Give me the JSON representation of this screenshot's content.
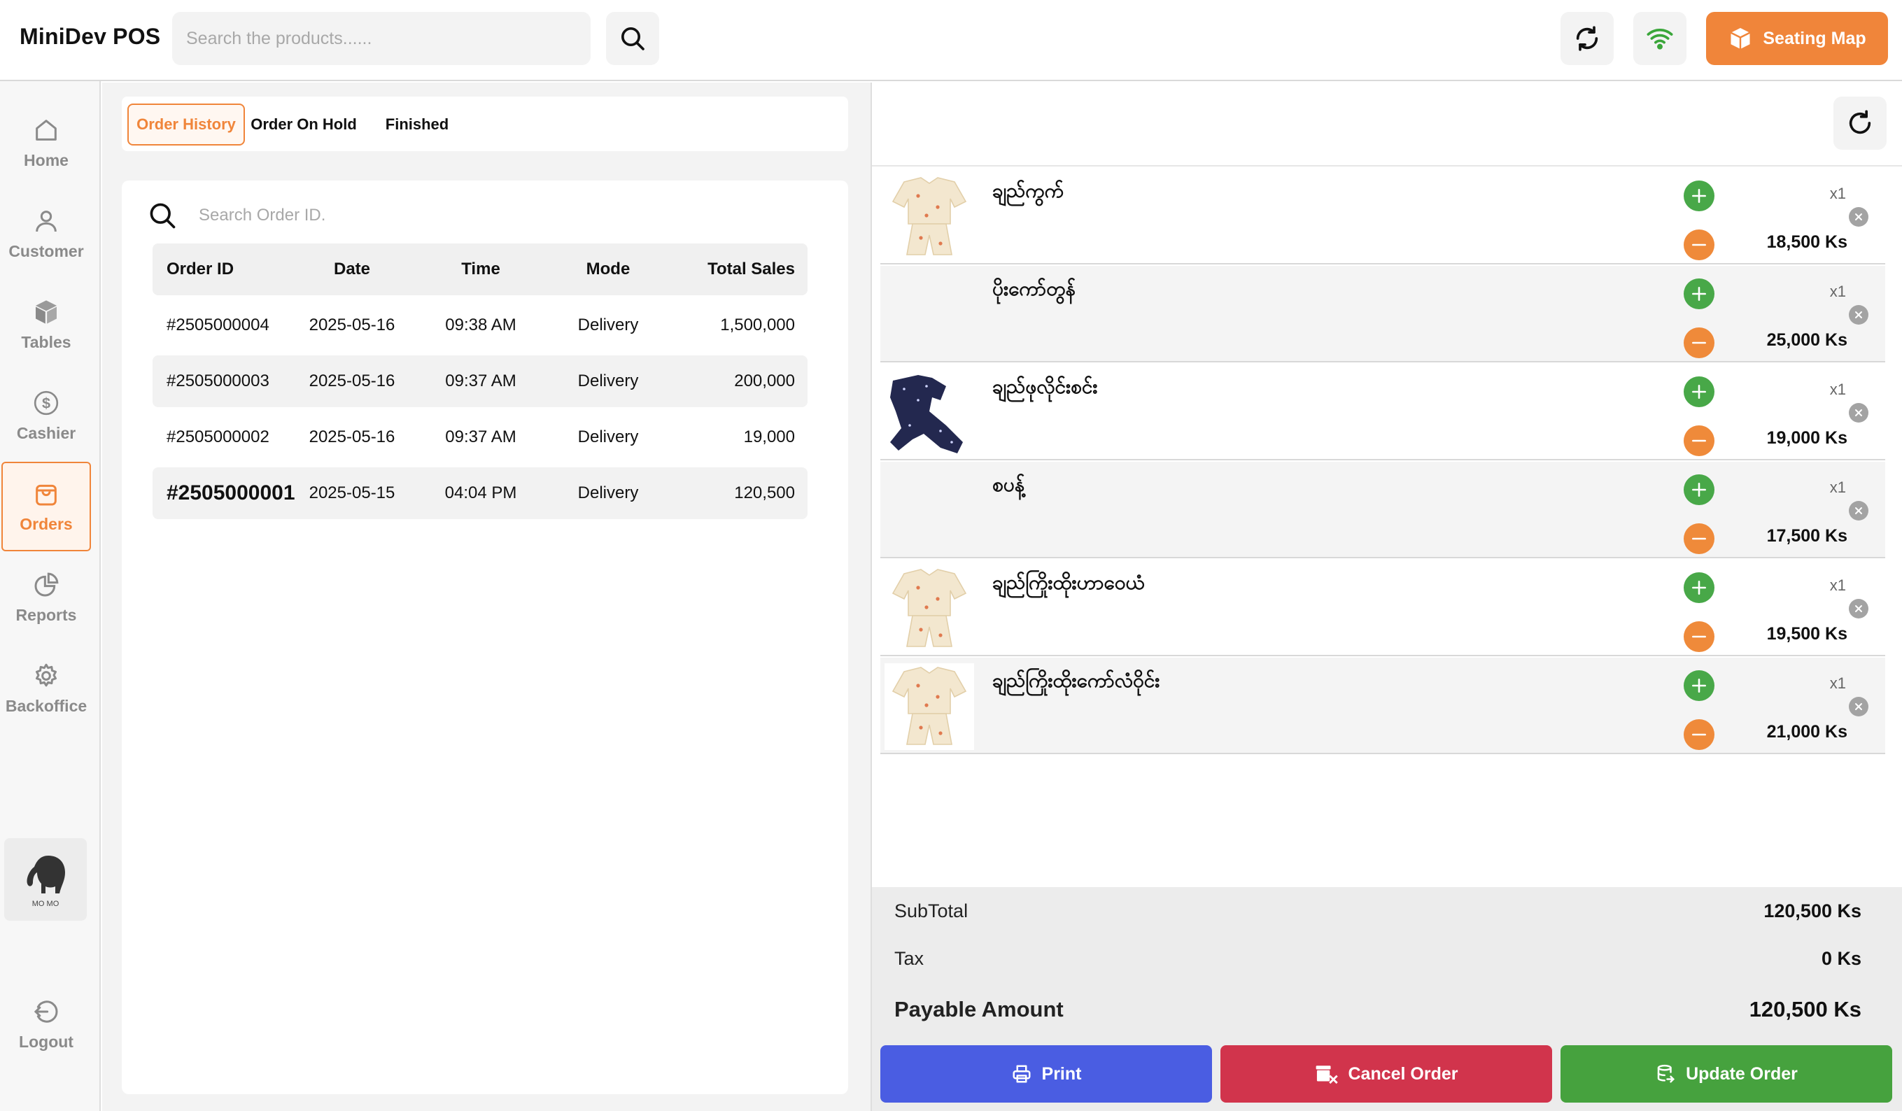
{
  "app": {
    "title": "MiniDev POS"
  },
  "topbar": {
    "search_placeholder": "Search the products......",
    "seating_label": "Seating Map",
    "accent_color": "#f0853a"
  },
  "sidebar": {
    "items": [
      {
        "label": "Home",
        "icon": "home-icon"
      },
      {
        "label": "Customer",
        "icon": "user-icon"
      },
      {
        "label": "Tables",
        "icon": "cube-icon"
      },
      {
        "label": "Cashier",
        "icon": "dollar-icon"
      },
      {
        "label": "Orders",
        "icon": "bag-icon",
        "active": true
      },
      {
        "label": "Reports",
        "icon": "pie-chart-icon"
      },
      {
        "label": "Backoffice",
        "icon": "gear-icon"
      }
    ],
    "avatar_text": "MO MO",
    "logout_label": "Logout"
  },
  "orders": {
    "tabs": [
      {
        "label": "Order History",
        "active": true
      },
      {
        "label": "Order On Hold"
      },
      {
        "label": "Finished"
      }
    ],
    "search_placeholder": "Search Order ID.",
    "columns": [
      "Order ID",
      "Date",
      "Time",
      "Mode",
      "Total Sales"
    ],
    "rows": [
      {
        "id": "#2505000004",
        "date": "2025-05-16",
        "time": "09:38 AM",
        "mode": "Delivery",
        "total": "1,500,000"
      },
      {
        "id": "#2505000003",
        "date": "2025-05-16",
        "time": "09:37 AM",
        "mode": "Delivery",
        "total": "200,000"
      },
      {
        "id": "#2505000002",
        "date": "2025-05-16",
        "time": "09:37 AM",
        "mode": "Delivery",
        "total": "19,000"
      },
      {
        "id": "#2505000001",
        "date": "2025-05-15",
        "time": "04:04 PM",
        "mode": "Delivery",
        "total": "120,500",
        "selected": true
      }
    ]
  },
  "cart": {
    "items": [
      {
        "name": "ချည်ကွက်",
        "qty": "x1",
        "price": "18,500 Ks",
        "image": "cream-pajama"
      },
      {
        "name": "ပိုးကော်တွန်",
        "qty": "x1",
        "price": "25,000 Ks",
        "image": "none"
      },
      {
        "name": "ချည်ဖုလိုင်းစင်း",
        "qty": "x1",
        "price": "19,000 Ks",
        "image": "navy-pajama"
      },
      {
        "name": "စပန့်",
        "qty": "x1",
        "price": "17,500 Ks",
        "image": "none"
      },
      {
        "name": "ချည်ကြိုးထိုးဟာဝေယံ",
        "qty": "x1",
        "price": "19,500 Ks",
        "image": "cream-pajama"
      },
      {
        "name": "ချည်ကြိုးထိုးကော်လံဝိုင်း",
        "qty": "x1",
        "price": "21,000 Ks",
        "image": "cream-pajama"
      }
    ]
  },
  "totals": {
    "subtotal_label": "SubTotal",
    "subtotal_value": "120,500 Ks",
    "tax_label": "Tax",
    "tax_value": "0 Ks",
    "payable_label": "Payable Amount",
    "payable_value": "120,500 Ks"
  },
  "actions": {
    "print_label": "Print",
    "cancel_label": "Cancel Order",
    "update_label": "Update Order",
    "print_color": "#4a5de2",
    "cancel_color": "#d1344c",
    "update_color": "#46a23e"
  }
}
